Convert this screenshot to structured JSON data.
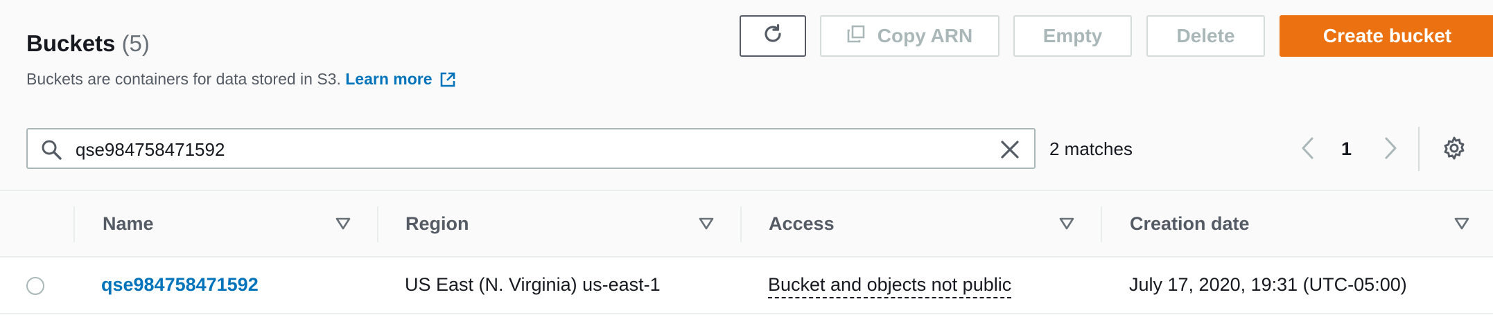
{
  "header": {
    "title": "Buckets",
    "count": "(5)",
    "description": "Buckets are containers for data stored in S3.",
    "learn_more": "Learn more"
  },
  "toolbar": {
    "refresh_icon": "refresh-icon",
    "copy_arn_label": "Copy ARN",
    "copy_icon": "copy-icon",
    "empty_label": "Empty",
    "delete_label": "Delete",
    "create_label": "Create bucket"
  },
  "search": {
    "value": "qse984758471592",
    "matches": "2 matches"
  },
  "pagination": {
    "current_page": "1"
  },
  "table": {
    "columns": [
      "Name",
      "Region",
      "Access",
      "Creation date"
    ],
    "rows": [
      {
        "name": "qse984758471592",
        "region": "US East (N. Virginia) us-east-1",
        "access": "Bucket and objects not public",
        "creation_date": "July 17, 2020, 19:31 (UTC-05:00)",
        "selected": false
      }
    ]
  },
  "colors": {
    "primary_button": "#ec7211",
    "link": "#0073bb",
    "disabled_text": "#aab7b8",
    "header_text": "#545b64"
  }
}
